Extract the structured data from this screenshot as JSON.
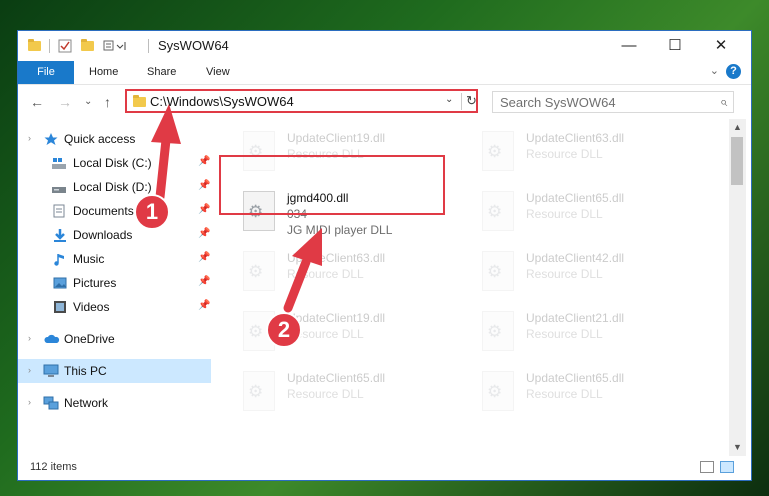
{
  "window": {
    "title": "SysWOW64",
    "buttons": {
      "minimize": "—",
      "maximize": "☐",
      "close": "✕"
    }
  },
  "ribbon": {
    "tabs": [
      "File",
      "Home",
      "Share",
      "View"
    ],
    "collapse": "⌄",
    "help": "?"
  },
  "address": {
    "path": "C:\\Windows\\SysWOW64",
    "dropdown": "⌄",
    "refresh": "↻",
    "search_placeholder": "Search SysWOW64",
    "search_icon": "⌕"
  },
  "nav_buttons": {
    "back": "←",
    "forward": "→",
    "recent": "⌄",
    "up": "↑"
  },
  "sidebar": {
    "quick_access": "Quick access",
    "items": [
      {
        "label": "Local Disk (C:)",
        "icon": "drive-icon"
      },
      {
        "label": "Local Disk (D:)",
        "icon": "drive-icon"
      },
      {
        "label": "Documents",
        "icon": "documents-icon"
      },
      {
        "label": "Downloads",
        "icon": "downloads-icon"
      },
      {
        "label": "Music",
        "icon": "music-icon"
      },
      {
        "label": "Pictures",
        "icon": "pictures-icon"
      },
      {
        "label": "Videos",
        "icon": "videos-icon"
      }
    ],
    "onedrive": "OneDrive",
    "this_pc": "This PC",
    "network": "Network",
    "pin_glyph": "📌"
  },
  "files": [
    {
      "name": "UpdateClient19.dll",
      "type": "Resource DLL"
    },
    {
      "name": "UpdateClient63.dll",
      "type": "Resource DLL"
    },
    {
      "name": "jgmd400.dll",
      "type": "034",
      "desc": "JG MIDI player DLL"
    },
    {
      "name": "UpdateClient65.dll",
      "type": "Resource DLL"
    },
    {
      "name": "UpdateClient63.dll",
      "type": "Resource DLL"
    },
    {
      "name": "UpdateClient42.dll",
      "type": "Resource DLL"
    },
    {
      "name": "UpdateClient19.dll",
      "type": "Resource DLL"
    },
    {
      "name": "UpdateClient21.dll",
      "type": "Resource DLL"
    },
    {
      "name": "UpdateClient65.dll",
      "type": "Resource DLL"
    },
    {
      "name": "UpdateClient65.dll",
      "type": "Resource DLL"
    }
  ],
  "status": {
    "item_count": "112 items"
  },
  "scrollbar": {
    "up": "▲",
    "down": "▼"
  },
  "annotations": {
    "step1": "1",
    "step2": "2"
  },
  "colors": {
    "accent": "#1979ca",
    "highlight": "#e03a45",
    "selection": "#cce8ff"
  }
}
